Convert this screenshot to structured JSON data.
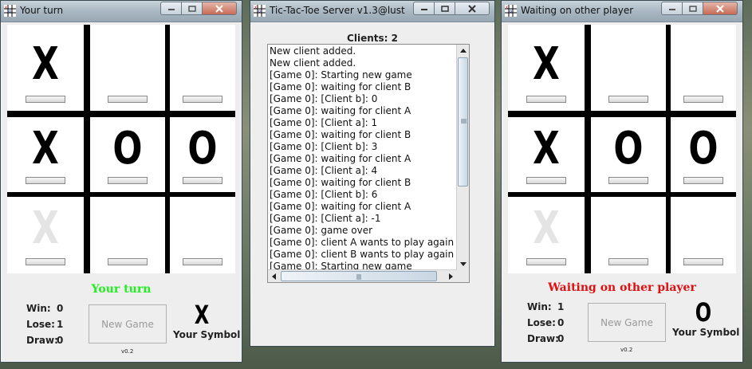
{
  "left_window": {
    "title": "Your turn",
    "status": "Your turn",
    "status_color": "#22ee22",
    "board": [
      {
        "symbol": "X",
        "ghost": false
      },
      {
        "symbol": "",
        "ghost": false
      },
      {
        "symbol": "",
        "ghost": false
      },
      {
        "symbol": "X",
        "ghost": false
      },
      {
        "symbol": "O",
        "ghost": false
      },
      {
        "symbol": "O",
        "ghost": false
      },
      {
        "symbol": "X",
        "ghost": true
      },
      {
        "symbol": "",
        "ghost": false
      },
      {
        "symbol": "",
        "ghost": false
      }
    ],
    "stats": {
      "win_label": "Win:",
      "win": "0",
      "lose_label": "Lose:",
      "lose": "1",
      "draw_label": "Draw:",
      "draw": "0"
    },
    "new_game_label": "New Game",
    "your_symbol": "X",
    "your_symbol_label": "Your Symbol",
    "version": "v0.2"
  },
  "server_window": {
    "title": "Tic-Tac-Toe Server v1.3@lust",
    "clients_label": "Clients: 2",
    "log": [
      "New client added.",
      "New client added.",
      "[Game 0]: Starting new game",
      "[Game 0]: waiting for client B",
      "[Game 0]: [Client b]: 0",
      "[Game 0]: waiting for client A",
      "[Game 0]: [Client a]: 1",
      "[Game 0]: waiting for client B",
      "[Game 0]: [Client b]: 3",
      "[Game 0]: waiting for client A",
      "[Game 0]: [Client a]: 4",
      "[Game 0]: waiting for client B",
      "[Game 0]: [Client b]: 6",
      "[Game 0]: waiting for client A",
      "[Game 0]: [Client a]: -1",
      "[Game 0]: game over",
      "[Game 0]: client A wants to play again",
      "[Game 0]: client B wants to play again",
      "[Game 0]: Starting new game"
    ]
  },
  "right_window": {
    "title": "Waiting on other player",
    "status": "Waiting on other player",
    "status_color": "#dd1111",
    "board": [
      {
        "symbol": "X",
        "ghost": false
      },
      {
        "symbol": "",
        "ghost": false
      },
      {
        "symbol": "",
        "ghost": false
      },
      {
        "symbol": "X",
        "ghost": false
      },
      {
        "symbol": "O",
        "ghost": false
      },
      {
        "symbol": "O",
        "ghost": false
      },
      {
        "symbol": "X",
        "ghost": true
      },
      {
        "symbol": "",
        "ghost": false
      },
      {
        "symbol": "",
        "ghost": false
      }
    ],
    "stats": {
      "win_label": "Win:",
      "win": "1",
      "lose_label": "Lose:",
      "lose": "0",
      "draw_label": "Draw:",
      "draw": "0"
    },
    "new_game_label": "New Game",
    "your_symbol": "O",
    "your_symbol_label": "Your Symbol",
    "version": "v0.2"
  }
}
